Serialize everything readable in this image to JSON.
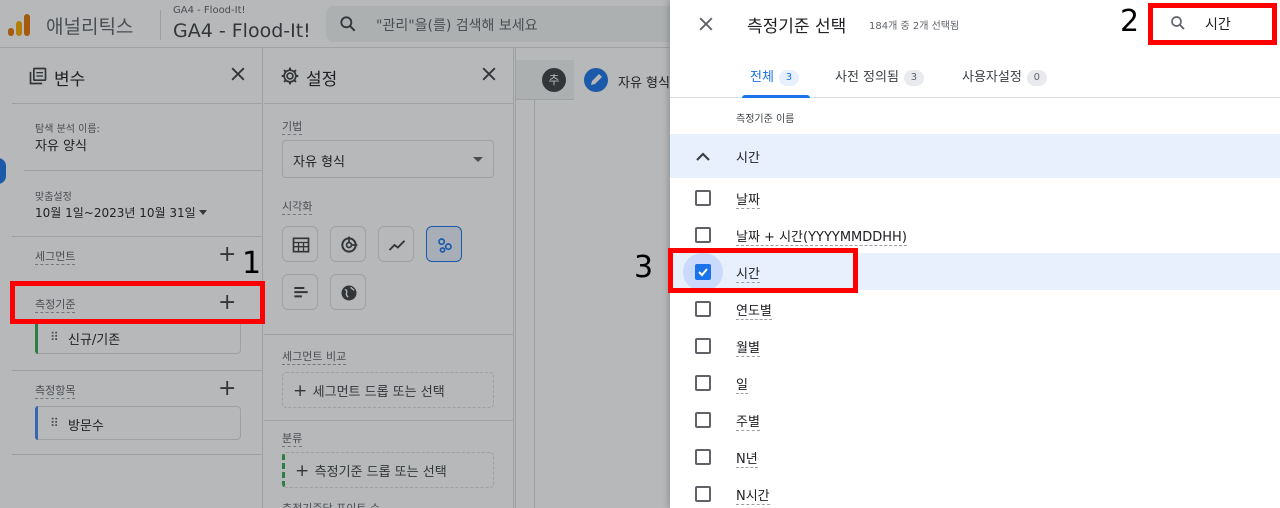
{
  "header": {
    "app_name": "애널리틱스",
    "property_small": "GA4 - Flood-It!",
    "property_name": "GA4 - Flood-It!",
    "search_placeholder": "\"관리\"을(를) 검색해 보세요"
  },
  "variables_panel": {
    "title": "변수",
    "exploration_label": "탐색 분석 이름:",
    "exploration_name": "자유 양식",
    "date_label": "맞춤설정",
    "date_range": "10월 1일~2023년 10월 31일",
    "segments_label": "세그먼트",
    "dimensions_label": "측정기준",
    "dimension_chip": "신규/기존",
    "metrics_label": "측정항목",
    "metric_chip": "방문수"
  },
  "settings_panel": {
    "title": "설정",
    "technique_label": "기법",
    "technique_value": "자유 형식",
    "visualization_label": "시각화",
    "segment_compare_label": "세그먼트 비교",
    "segment_drop": "세그먼트 드롭 또는 선택",
    "rows_label": "분류",
    "rows_drop": "측정기준 드롭 또는 선택",
    "cut_text": "측정기준당 표이트 수"
  },
  "canvas": {
    "add_tab": "추",
    "active_tab": "자유 형식"
  },
  "drawer": {
    "title": "측정기준 선택",
    "selected_count": "184개 중 2개 선택됨",
    "search_value": "시간",
    "tabs": [
      {
        "label": "전체",
        "count": "3"
      },
      {
        "label": "사전 정의됨",
        "count": "3"
      },
      {
        "label": "사용자설정",
        "count": "0"
      }
    ],
    "column_header": "측정기준 이름",
    "group_label": "시간",
    "items": [
      {
        "label": "날짜",
        "checked": false
      },
      {
        "label": "날짜 + 시간(YYYYMMDDHH)",
        "checked": false
      },
      {
        "label": "시간",
        "checked": true
      },
      {
        "label": "연도별",
        "checked": false
      },
      {
        "label": "월별",
        "checked": false
      },
      {
        "label": "일",
        "checked": false
      },
      {
        "label": "주별",
        "checked": false
      },
      {
        "label": "N년",
        "checked": false
      },
      {
        "label": "N시간",
        "checked": false
      }
    ]
  },
  "annotations": {
    "n1": "1",
    "n2": "2",
    "n3": "3"
  },
  "colors": {
    "accent": "#1a73e8",
    "annotation_red": "#ff0000",
    "selected_row": "#e8f0fe",
    "dimension_bar": "#34a853",
    "metric_bar": "#4285f4"
  }
}
